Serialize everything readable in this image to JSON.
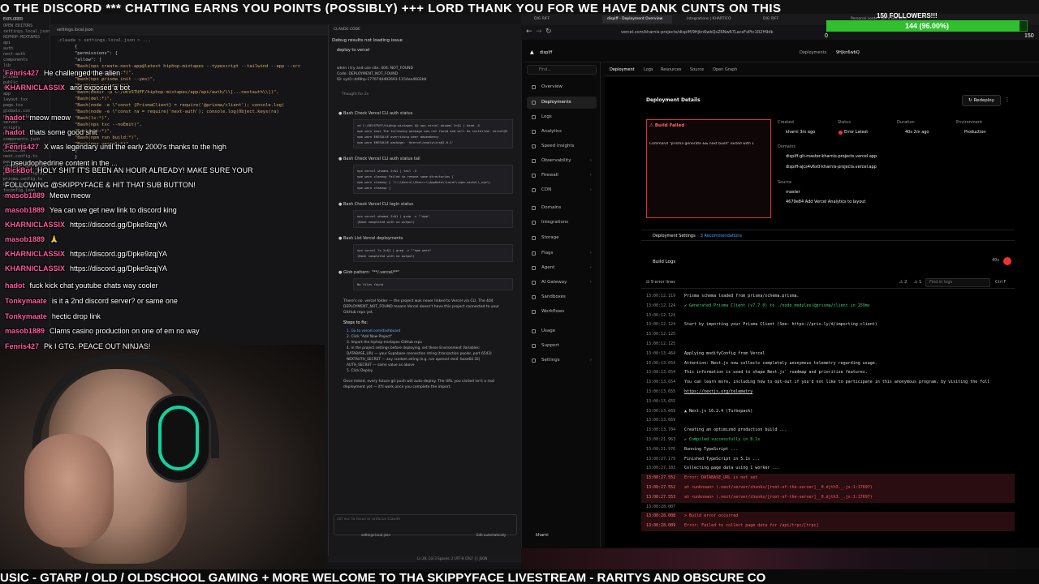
{
  "ticker_top": "O THE DISCORD *** CHATTING EARNS YOU POINTS (POSSIBLY) +++ LORD THANK YOU FOR WE HAVE DANK CUNTS ON THIS",
  "ticker_bottom": "USIC - GTARP / OLD / OLDSCHOOL GAMING + MORE WELCOME TO THA SKIPPYFACE LIVESTREAM - RARITYS AND OBSCURE CO",
  "chat": [
    {
      "user": "Fenris427",
      "text": "He challenged the alien"
    },
    {
      "user": "KHARNICLASSIX",
      "text": "and exposed a bot"
    },
    {
      "user": "hadot",
      "text": "meow meow"
    },
    {
      "user": "hadot",
      "text": "thats some good shit"
    },
    {
      "user": "Fenris427",
      "text": "X was legendary until the early 2000's thanks to the high"
    },
    {
      "user": "",
      "text": "...pseudophedrine content in the ..."
    },
    {
      "user": "BickBot",
      "text": "HOLY SHIT IT'S BEEN AN HOUR ALREADY! MAKE SURE YOUR"
    },
    {
      "user": "",
      "text": "FOLLOWING @SKIPPYFACE & HIT THAT SUB BUTTON!"
    },
    {
      "user": "masob1889",
      "text": "Meow meow"
    },
    {
      "user": "masob1889",
      "text": "Yea can we get new link to discord king"
    },
    {
      "user": "KHARNICLASSIX",
      "text": "https://discord.gg/Dpke9zqjYA"
    },
    {
      "user": "masob1889",
      "text": "🙏"
    },
    {
      "user": "KHARNICLASSIX",
      "text": "https://discord.gg/Dpke9zqjYA"
    },
    {
      "user": "KHARNICLASSIX",
      "text": "https://discord.gg/Dpke9zqjYA"
    },
    {
      "user": "hadot",
      "text": "fuck kick chat youtube chats way cooler"
    },
    {
      "user": "Tonkymaate",
      "text": "is it a 2nd discord server? or same one"
    },
    {
      "user": "Tonkymaate",
      "text": "hectic drop link"
    },
    {
      "user": "masob1889",
      "text": "Clams casino production on one of em no way"
    },
    {
      "user": "Fenris427",
      "text": "Pk I GTG. PEACE OUT NINJAS!"
    }
  ],
  "explorer": {
    "title": "EXPLORER",
    "items": [
      "OPEN EDITORS",
      "settings.local.json",
      "HIPHOP-MIXTAPES",
      "api",
      "auth",
      "next-auth",
      "components",
      "lib",
      "hooks",
      "prisma",
      "public",
      "types",
      "app",
      "layout.tsx",
      "page.tsx",
      "globals.css",
      "node_modules",
      "server",
      "scripts",
      "utils",
      "components.json",
      "AGENTS.md",
      "CLAUDE.md",
      "next.config.ts",
      "package.json",
      "package-lock.json",
      "postcss.config.mjs",
      "prisma.config.ts",
      "README.md",
      "tsconfig.json",
      "vercel.json"
    ]
  },
  "editor": {
    "tab": "settings.local.json",
    "breadcrumb": ".claude > settings.local.json > ...",
    "lines": [
      "{",
      "  \"permissions\": {",
      "    \"allow\": [",
      "      \"Bash(npx create-next-app@latest hiphop-mixtapes --typescript --tailwind --app --src",
      "      \"Bash(npm install:*)\",",
      "      \"Bash(npx prisma init --yes)\",",
      "      \"Bash(npx prisma:*)\",",
      "      \"Bash(mkdir -p C:/DEVSTUFF/hiphop-mixtapes/app/api/auth/\\\\[...nextauth\\\\])\",",
      "      \"Bash(del:*)\",",
      "      \"Bash(node -e \\\"const {PrismaClient} = require('@prisma/client'); console.log(",
      "      \"Bash(node -e \\\"const ra = require('next-auth'); console.log(Object.keys(ra)",
      "      \"Bash(ls:*)\",",
      "      \"Bash(npx tsc --noEmit)\",",
      "      \"Bash(git:*)\",",
      "      \"Bash(npm run build:*)\",",
      "      \"Bash(npx vercel:*)\"",
      "    ]",
      "  }",
      "}"
    ]
  },
  "claude_panel": {
    "header": "CLAUDE CODE",
    "title": "Debug results not loading issue",
    "prompt": "deploy to vercel",
    "error_lines": [
      "when i try and use site. 404: NOT_FOUND",
      "Code: DEPLOYMENT_NOT_FOUND",
      "ID: syd1::dd9hp-1776740492691-1154ee4602b9"
    ],
    "thought": "Thought for 2s",
    "steps": [
      {
        "title": "Bash  Check Vercel CLI auth status",
        "lines": [
          "cd C:/DEVSTUFF/hiphop-mixtapes && npx vercel whoami 2>&1 | head -5",
          "npm warn exec The following package was not found and will be installed: vercel@5",
          "npm warn ERESOLVE overriding peer dependency",
          "npm warn ERESOLVE   package: '@vercel/analytics@2.0.1'"
        ]
      },
      {
        "title": "Bash  Check Vercel CLI auth status tail",
        "lines": [
          "npx vercel whoami 2>&1 | tail -5",
          "npm warn cleanup   Failed to remove some directories [",
          "npm warn cleanup     [ 'C:\\\\Users\\\\Sharrr\\\\AppData\\\\Local\\\\npm-cache\\\\_npx\\\\",
          "npm warn cleanup   ]"
        ]
      },
      {
        "title": "Bash  Check Vercel CLI login status",
        "lines": [
          "npx vercel whoami 2>&1 | grep -v \"^npm\"",
          "(Bash completed with no output)"
        ]
      },
      {
        "title": "Bash  List Vercel deployments",
        "lines": [
          "npx vercel ls 2>&1 | grep -v \"^npm warn\"",
          "(Bash completed with no output)"
        ]
      },
      {
        "title": "Glob  pattern: \"**/.vercel/**\"",
        "lines": [
          "No files found"
        ]
      }
    ],
    "summary": "There's no .vercel folder — the project was never linked to Vercel via CLI. The 404 DEPLOYMENT_NOT_FOUND means Vercel doesn't have this project connected to your GitHub repo yet.",
    "steps_to_fix": "Steps to fix:",
    "fix_list": [
      "1. Go to vercel.com/dashboard",
      "2. Click \"Add New Project\"",
      "3. Import the hiphop-mixtapes GitHub repo",
      "4. In the project settings before deploying, set these Environment Variables:",
      "   DATABASE_URL — your Supabase connection string (transaction pooler, port 6543)",
      "   NEXTAUTH_SECRET — any random string (e.g. run openssl rand -base64 32)",
      "   AUTH_SECRET — same value as above",
      "5. Click Deploy"
    ],
    "outro": "Once linked, every future git push will auto-deploy. The URL you visited isn't a real deployment yet — it'll work once you complete the import.",
    "input_placeholder": "ctrl esc to focus or unfocus Claude",
    "file_chip": "settings.local.json",
    "mode": "Edit automatically",
    "status": "Ln 28, Col 3   Spaces: 2   UTF-8   CRLF   {}   JSON"
  },
  "browser": {
    "tabs": [
      "DIG RIFF",
      "dispiff - Deployment Overview",
      "Integrations | KHARTICO",
      "DIG RIFF",
      "Personal Lorde - Let's Get Wild"
    ],
    "url": "vercel.com/kharnis-projects/dispiff/9Hjkn6wbQsZ6Nw67LacsFxPtc1R2H9dk"
  },
  "followers": {
    "title": "150 FOLLOWERS!!!",
    "text": "144 (96.00%)",
    "min": "0",
    "max": "150",
    "progress": 0.96
  },
  "vercel": {
    "project": "dispiff",
    "crumb_deploy": "Deployments",
    "crumb_id": "9Hjkn6wbQ",
    "nav": [
      {
        "label": "Overview",
        "active": false,
        "chev": false
      },
      {
        "label": "Deployments",
        "active": true,
        "chev": false
      },
      {
        "label": "Logs",
        "active": false,
        "chev": false
      },
      {
        "label": "Analytics",
        "active": false,
        "chev": false
      },
      {
        "label": "Speed Insights",
        "active": false,
        "chev": false
      },
      {
        "label": "Observability",
        "active": false,
        "chev": true
      },
      {
        "label": "Firewall",
        "active": false,
        "chev": true
      },
      {
        "label": "CDN",
        "active": false,
        "chev": true
      },
      {
        "label": "Domains",
        "active": false,
        "chev": false
      },
      {
        "label": "Integrations",
        "active": false,
        "chev": false
      },
      {
        "label": "Storage",
        "active": false,
        "chev": false
      },
      {
        "label": "Flags",
        "active": false,
        "chev": true
      },
      {
        "label": "Agent",
        "active": false,
        "chev": true
      },
      {
        "label": "AI Gateway",
        "active": false,
        "chev": true
      },
      {
        "label": "Sandboxes",
        "active": false,
        "chev": false
      },
      {
        "label": "Workflows",
        "active": false,
        "chev": false
      },
      {
        "label": "Usage",
        "active": false,
        "chev": false
      },
      {
        "label": "Support",
        "active": false,
        "chev": false
      },
      {
        "label": "Settings",
        "active": false,
        "chev": true
      }
    ],
    "tabs": [
      "Deployment",
      "Logs",
      "Resources",
      "Source",
      "Open Graph"
    ],
    "details_title": "Deployment Details",
    "redeploy": "Redeploy",
    "build_failed": "Build Failed",
    "build_cmd": "Command \"prisma generate && next build\" exited with 1",
    "created_label": "Created",
    "created_val": "kharni  3m ago",
    "status_label": "Status",
    "status_val": "Error  Latest",
    "duration_label": "Duration",
    "duration_val": "40s  2m ago",
    "env_label": "Environment",
    "env_val": "Production",
    "domains_label": "Domains",
    "domain1": "dispiff-git-master-kharnis-projects.vercel.app",
    "domain2": "dispiff-ajcs4v6x0-kharnis-projects.vercel.app",
    "source_label": "Source",
    "source_branch": "master",
    "source_commit": "4679e84  Add Vercel Analytics to layout",
    "settings_label": "Deployment Settings",
    "settings_badge": "3 Recommendations",
    "logs_label": "Build Logs",
    "logs_time": "40s",
    "log_lines_btn": "9 error lines",
    "log_warn": "2",
    "log_errs": "1",
    "log_search": "Find in logs",
    "log_ctrl": "Ctrl F",
    "user": "kharni",
    "logs": [
      {
        "ts": "13:00:12.119",
        "msg": "Prisma schema loaded from prisma/schema.prisma.",
        "type": "normal"
      },
      {
        "ts": "13:00:12.124",
        "msg": "✔ Generated Prisma Client (v7.7.0) to ./node_modules/@prisma/client in 159ms",
        "type": "ok"
      },
      {
        "ts": "13:00:12.124",
        "msg": "",
        "type": "normal"
      },
      {
        "ts": "13:00:12.124",
        "msg": "Start by importing your Prisma Client (See: https://pris.ly/d/importing-client)",
        "type": "normal"
      },
      {
        "ts": "13:00:12.125",
        "msg": "",
        "type": "normal"
      },
      {
        "ts": "13:00:12.125",
        "msg": "",
        "type": "normal"
      },
      {
        "ts": "13:00:13.464",
        "msg": "  Applying modifyConfig from Vercel",
        "type": "normal"
      },
      {
        "ts": "13:00:13.654",
        "msg": "Attention: Next.js now collects completely anonymous telemetry regarding usage.",
        "type": "normal"
      },
      {
        "ts": "13:00:13.654",
        "msg": "This information is used to shape Next.js' roadmap and prioritize features.",
        "type": "normal"
      },
      {
        "ts": "13:00:13.654",
        "msg": "You can learn more, including how to opt-out if you'd not like to participate in this anonymous program, by visiting the foll",
        "type": "normal"
      },
      {
        "ts": "13:00:13.655",
        "msg": "https://nextjs.org/telemetry",
        "type": "link"
      },
      {
        "ts": "13:00:13.655",
        "msg": "",
        "type": "normal"
      },
      {
        "ts": "13:00:13.669",
        "msg": "▲ Next.js 16.2.4 (Turbopack)",
        "type": "normal"
      },
      {
        "ts": "13:00:13.669",
        "msg": "",
        "type": "normal"
      },
      {
        "ts": "13:00:13.704",
        "msg": "  Creating an optimized production build ...",
        "type": "normal"
      },
      {
        "ts": "13:00:21.963",
        "msg": "✔ Compiled successfully in 8.1s",
        "type": "ok"
      },
      {
        "ts": "13:00:21.976",
        "msg": "  Running TypeScript ...",
        "type": "normal"
      },
      {
        "ts": "13:00:27.179",
        "msg": "  Finished TypeScript in 5.1s ...",
        "type": "normal"
      },
      {
        "ts": "13:00:27.183",
        "msg": "  Collecting page data using 1 worker ...",
        "type": "normal"
      },
      {
        "ts": "13:00:27.552",
        "msg": "Error: DATABASE_URL is not set",
        "type": "err"
      },
      {
        "ts": "13:00:27.552",
        "msg": "    at <unknown> (.next/server/chunks/[root-of-the-server]__0.djth3._.js:1:17697)",
        "type": "err"
      },
      {
        "ts": "13:00:27.553",
        "msg": "    at <unknown> (.next/server/chunks/[root-of-the-server]__0.djth3._.js:1:17697)",
        "type": "err"
      },
      {
        "ts": "13:00:28.007",
        "msg": "",
        "type": "normal"
      },
      {
        "ts": "13:00:28.008",
        "msg": "> Build error occurred",
        "type": "err"
      },
      {
        "ts": "13:00:28.009",
        "msg": "Error: Failed to collect page data for /api/trpc/[trpc]",
        "type": "err"
      }
    ]
  }
}
